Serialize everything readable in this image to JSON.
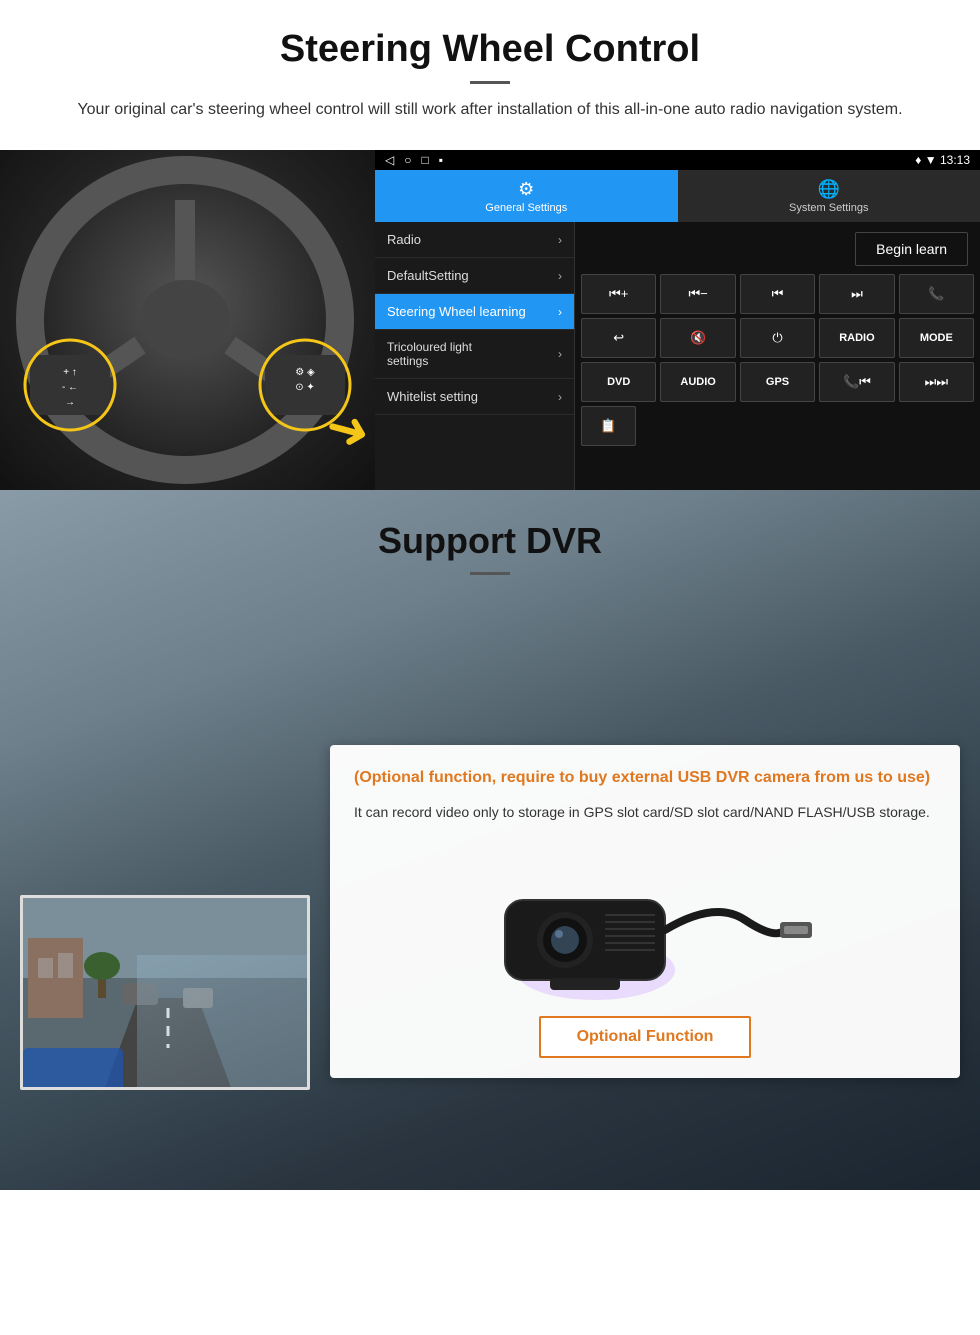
{
  "steering_section": {
    "title": "Steering Wheel Control",
    "subtitle": "Your original car's steering wheel control will still work after installation of this all-in-one auto radio navigation system.",
    "android_ui": {
      "status_bar": {
        "icons_left": "◁  ○  □  ▪",
        "icons_right": "♦ ▼ 13:13"
      },
      "tab_general": {
        "icon": "⚙",
        "label": "General Settings"
      },
      "tab_system": {
        "icon": "🌐",
        "label": "System Settings"
      },
      "menu_items": [
        {
          "label": "Radio",
          "active": false
        },
        {
          "label": "DefaultSetting",
          "active": false
        },
        {
          "label": "Steering Wheel learning",
          "active": true
        },
        {
          "label": "Tricoloured light settings",
          "active": false
        },
        {
          "label": "Whitelist setting",
          "active": false
        }
      ],
      "begin_learn_label": "Begin learn",
      "control_rows": [
        [
          "⏮+",
          "⏮-",
          "⏮",
          "⏭",
          "📞"
        ],
        [
          "↩",
          "🔇",
          "⏻",
          "RADIO",
          "MODE"
        ],
        [
          "DVD",
          "AUDIO",
          "GPS",
          "📞⏮",
          "⏭⏭"
        ]
      ],
      "extra_btn": "📋"
    }
  },
  "dvr_section": {
    "title": "Support DVR",
    "orange_title": "(Optional function, require to buy external USB DVR camera from us to use)",
    "description": "It can record video only to storage in GPS slot card/SD slot card/NAND FLASH/USB storage.",
    "optional_button_label": "Optional Function"
  }
}
